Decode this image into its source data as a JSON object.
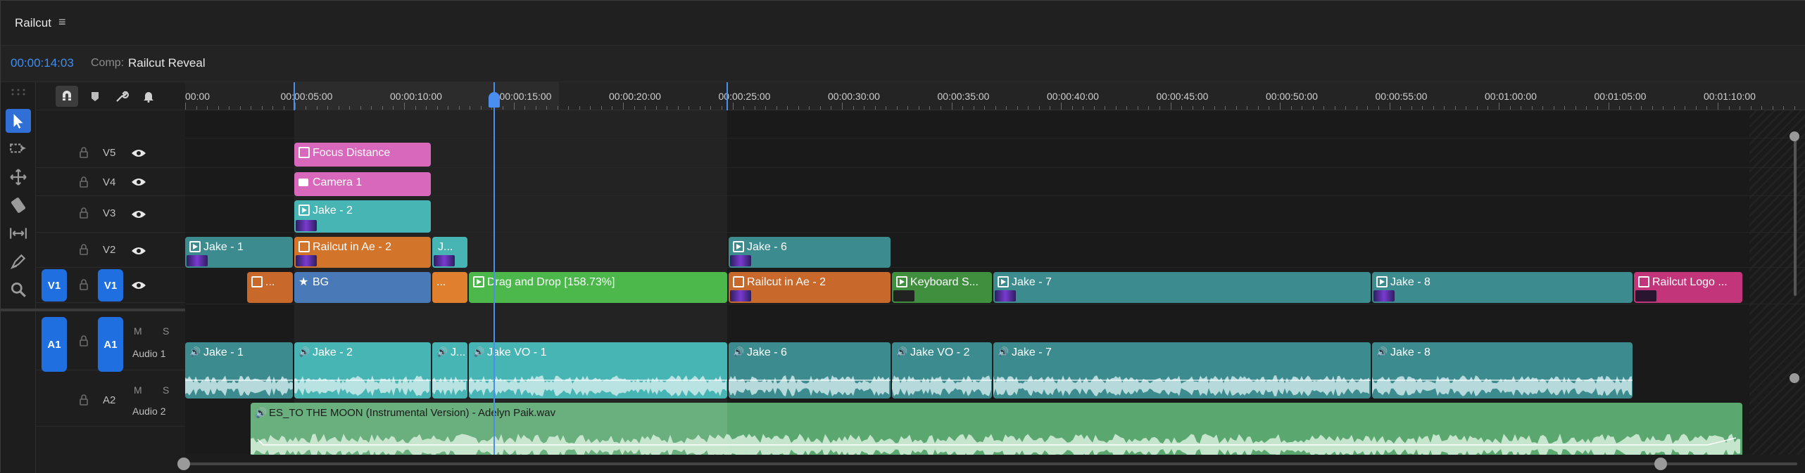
{
  "app": {
    "title": "Railcut",
    "menu_glyph": "≡"
  },
  "info": {
    "timecode": "00:00:14:03",
    "comp_label": "Comp:",
    "comp_name": "Railcut Reveal"
  },
  "ruler": {
    "labels": [
      "00:00",
      "00:00:05:00",
      "00:00:10:00",
      "00:00:15:00",
      "00:00:20:00",
      "00:00:25:00",
      "00:00:30:00",
      "00:00:35:00",
      "00:00:40:00",
      "00:00:45:00",
      "00:00:50:00",
      "00:00:55:00",
      "00:01:00:00",
      "00:01:05:00",
      "00:01:10:00"
    ]
  },
  "tracks": {
    "video": [
      {
        "name": "V5"
      },
      {
        "name": "V4"
      },
      {
        "name": "V3"
      },
      {
        "name": "V2"
      },
      {
        "name": "V1",
        "patch": "V1"
      }
    ],
    "audio": [
      {
        "name": "A1",
        "patch": "A1",
        "m": "M",
        "s": "S",
        "label": "Audio 1"
      },
      {
        "name": "A2",
        "m": "M",
        "s": "S",
        "label": "Audio 2"
      }
    ]
  },
  "clips": {
    "v5": [
      {
        "label": "Focus Distance"
      }
    ],
    "v4": [
      {
        "label": "Camera 1"
      }
    ],
    "v3": [
      {
        "label": "Jake - 2"
      }
    ],
    "v2": [
      {
        "label": "Jake - 1"
      },
      {
        "label": "Railcut in Ae - 2"
      },
      {
        "label": "J..."
      },
      {
        "label": "Jake - 6"
      }
    ],
    "v1": [
      {
        "label": "..."
      },
      {
        "label": "BG"
      },
      {
        "label": "..."
      },
      {
        "label": "Drag and Drop [158.73%]"
      },
      {
        "label": "Railcut in Ae - 2"
      },
      {
        "label": "Keyboard S..."
      },
      {
        "label": "Jake - 7"
      },
      {
        "label": "Jake - 8"
      },
      {
        "label": "Railcut Logo ..."
      }
    ],
    "a1": [
      {
        "label": "Jake - 1"
      },
      {
        "label": "Jake - 2"
      },
      {
        "label": "J..."
      },
      {
        "label": "Jake VO - 1"
      },
      {
        "label": "Jake - 6"
      },
      {
        "label": "Jake VO - 2"
      },
      {
        "label": "Jake - 7"
      },
      {
        "label": "Jake - 8"
      }
    ],
    "a2": [
      {
        "label": "ES_TO THE MOON (Instrumental Version) - Adelyn Paik.wav"
      }
    ]
  },
  "colors": {
    "teal": "#3b8b8f",
    "teal_light": "#48b5b5",
    "orange": "#d2742a",
    "pink": "#d868bc",
    "blue": "#4a79b8",
    "green": "#4cb84c",
    "dark_green": "#3f8f3f",
    "magenta": "#c2357a",
    "music_green": "#5aa870",
    "accent": "#3f8ef0"
  },
  "icons": [
    "select-icon",
    "track-select-icon",
    "ripple-icon",
    "razor-icon",
    "slip-icon",
    "pen-icon",
    "zoom-icon",
    "snap-icon",
    "marker-icon",
    "wrench-icon",
    "bell-icon",
    "lock-icon",
    "eye-icon"
  ]
}
